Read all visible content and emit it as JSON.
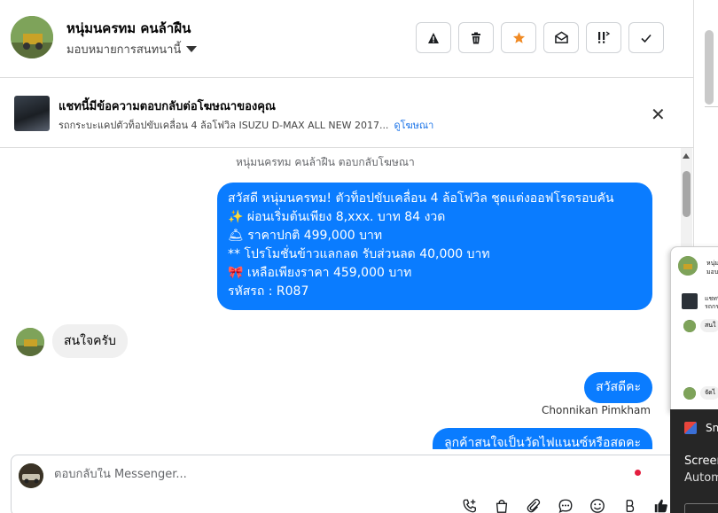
{
  "header": {
    "name": "หนุ่มนครทม คนล้าฝืน",
    "assign_label": "มอบหมายการสนทนานี้",
    "actions": [
      {
        "icon": "warning-icon",
        "glyph": "▲"
      },
      {
        "icon": "trash-icon",
        "glyph": "🗑"
      },
      {
        "icon": "star-icon",
        "glyph": "★"
      },
      {
        "icon": "envelope-open-icon",
        "glyph": "✉"
      },
      {
        "icon": "follow-up-icon",
        "glyph": "!!"
      },
      {
        "icon": "check-icon",
        "glyph": "✓"
      }
    ]
  },
  "ad_banner": {
    "title": "แชทนี้มีข้อความตอบกลับต่อโฆษณาของคุณ",
    "description": "รถกระบะแคปตัวท็อปขับเคลื่อน 4 ล้อโฟวิล ISUZU D-MAX ALL NEW 2017...",
    "link": "ดูโฆษณา",
    "close_glyph": "✕"
  },
  "chat": {
    "system_note": "หนุ่มนครทม คนล้าฝืน ตอบกลับโฆษณา",
    "ad_reply_lines": [
      "สวัสดี หนุ่มนครทม! ตัวท็อปขับเคลื่อน 4 ล้อโฟวิล ชุดแต่งออฟโรดรอบคัน",
      "✨  ผ่อนเริ่มต้นเพียง 8,xxx. บาท 84 งวด",
      "🛎 ราคาปกติ 499,000 บาท",
      "** โปรโมชั่นข้าวแลกลด รับส่วนลด 40,000 บาท",
      "🎀  เหลือเพียงราคา 459,000 บาท",
      " รหัสรถ : R087"
    ],
    "incoming_message": "สนใจครับ",
    "outgoing_greeting": "สวัสดีคะ",
    "sender_name": "Chonnikan Pimkham",
    "outgoing_partial": "ลูกค้าสนใจเป็นวัดไฟแนนซ์หรือสดคะ"
  },
  "reply_box": {
    "placeholder": "ตอบกลับใน Messenger..."
  },
  "mini_popup": {
    "name_line1": "หนุ่ม",
    "name_line2": "มอบ",
    "ad_line1": "แชทนี้",
    "ad_line2": "รถกระ",
    "msg1": "สนใ",
    "msg2": "จัดไ"
  },
  "dark_panel": {
    "app_name": "Sn",
    "line1": "Screen",
    "line2": "Autom"
  }
}
